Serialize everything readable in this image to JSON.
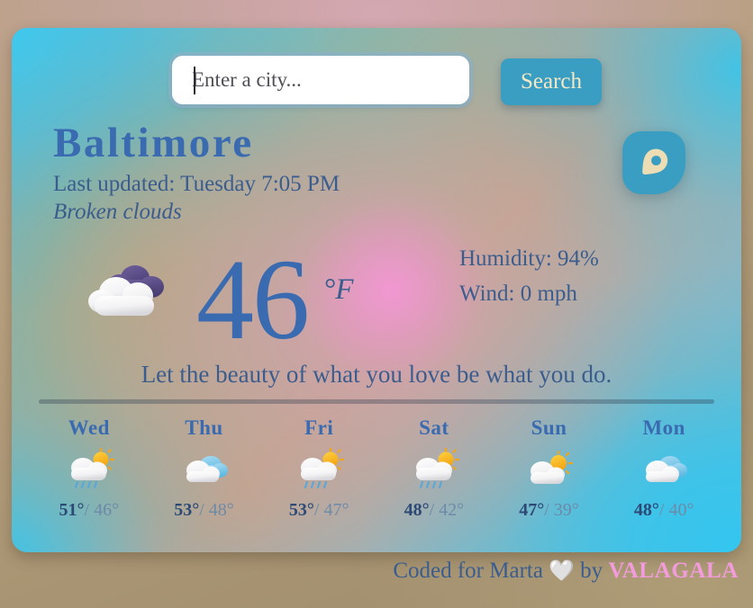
{
  "app": {
    "background_color": "#a89472",
    "card_accent": "#3a9ec2",
    "text_blue": "#3b5d8e",
    "title_blue": "#3a6bb0",
    "brand_pink": "#f29bdd"
  },
  "search": {
    "placeholder": "Enter a city...",
    "value": "",
    "button_label": "Search",
    "location_icon": "location-pin-icon"
  },
  "current": {
    "city": "Baltimore",
    "last_updated": "Last updated: Tuesday 7:05 PM",
    "description": "Broken clouds",
    "icon": "broken-clouds-icon",
    "temperature": "46",
    "unit": "°F",
    "humidity": "Humidity: 94%",
    "wind": "Wind: 0 mph"
  },
  "quote": "Let the beauty of what you love be what you do.",
  "forecast": [
    {
      "day": "Wed",
      "icon": "sun-rain-cloud-icon",
      "high": "51°",
      "sep": "/",
      "low": "46°"
    },
    {
      "day": "Thu",
      "icon": "cloudy-icon",
      "high": "53°",
      "sep": "/",
      "low": "48°"
    },
    {
      "day": "Fri",
      "icon": "sun-rain-cloud-icon",
      "high": "53°",
      "sep": "/",
      "low": "47°"
    },
    {
      "day": "Sat",
      "icon": "sun-rain-cloud-icon",
      "high": "48°",
      "sep": "/",
      "low": "42°"
    },
    {
      "day": "Sun",
      "icon": "sun-cloud-icon",
      "high": "47°",
      "sep": "/",
      "low": "39°"
    },
    {
      "day": "Mon",
      "icon": "cloudy-icon",
      "high": "48°",
      "sep": "/",
      "low": "40°"
    }
  ],
  "footer": {
    "prefix": "Coded for Marta",
    "heart": "🤍",
    "middle": "by",
    "brand": "VALAGALA"
  }
}
